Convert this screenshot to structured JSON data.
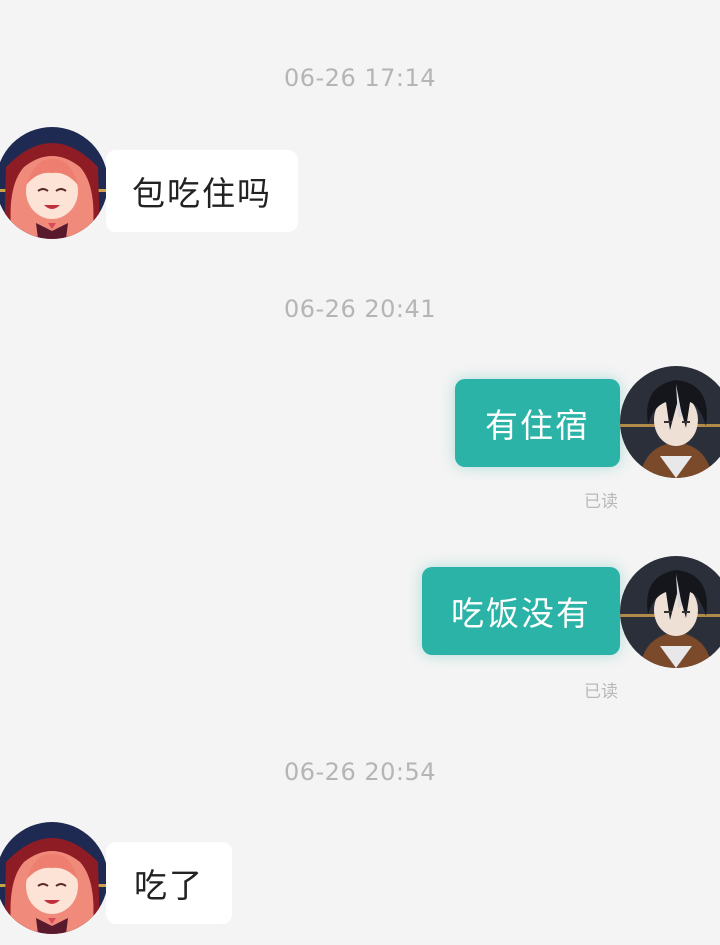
{
  "conversation": {
    "messages": [
      {
        "timestamp": "06-26 17:14",
        "direction": "incoming",
        "sender_avatar": "red-hood-girl-avatar",
        "text": "包吃住吗"
      },
      {
        "timestamp": "06-26 20:41",
        "direction": "outgoing",
        "sender_avatar": "dark-haired-man-avatar",
        "text": "有住宿",
        "status": "已读"
      },
      {
        "timestamp": "",
        "direction": "outgoing",
        "sender_avatar": "dark-haired-man-avatar",
        "text": "吃饭没有",
        "status": "已读"
      },
      {
        "timestamp": "06-26 20:54",
        "direction": "incoming",
        "sender_avatar": "red-hood-girl-avatar",
        "text": "吃了"
      }
    ]
  },
  "colors": {
    "background": "#f4f4f4",
    "incoming_bubble": "#ffffff",
    "outgoing_bubble": "#2ab3a6",
    "timestamp_text": "#b5b5b5"
  }
}
